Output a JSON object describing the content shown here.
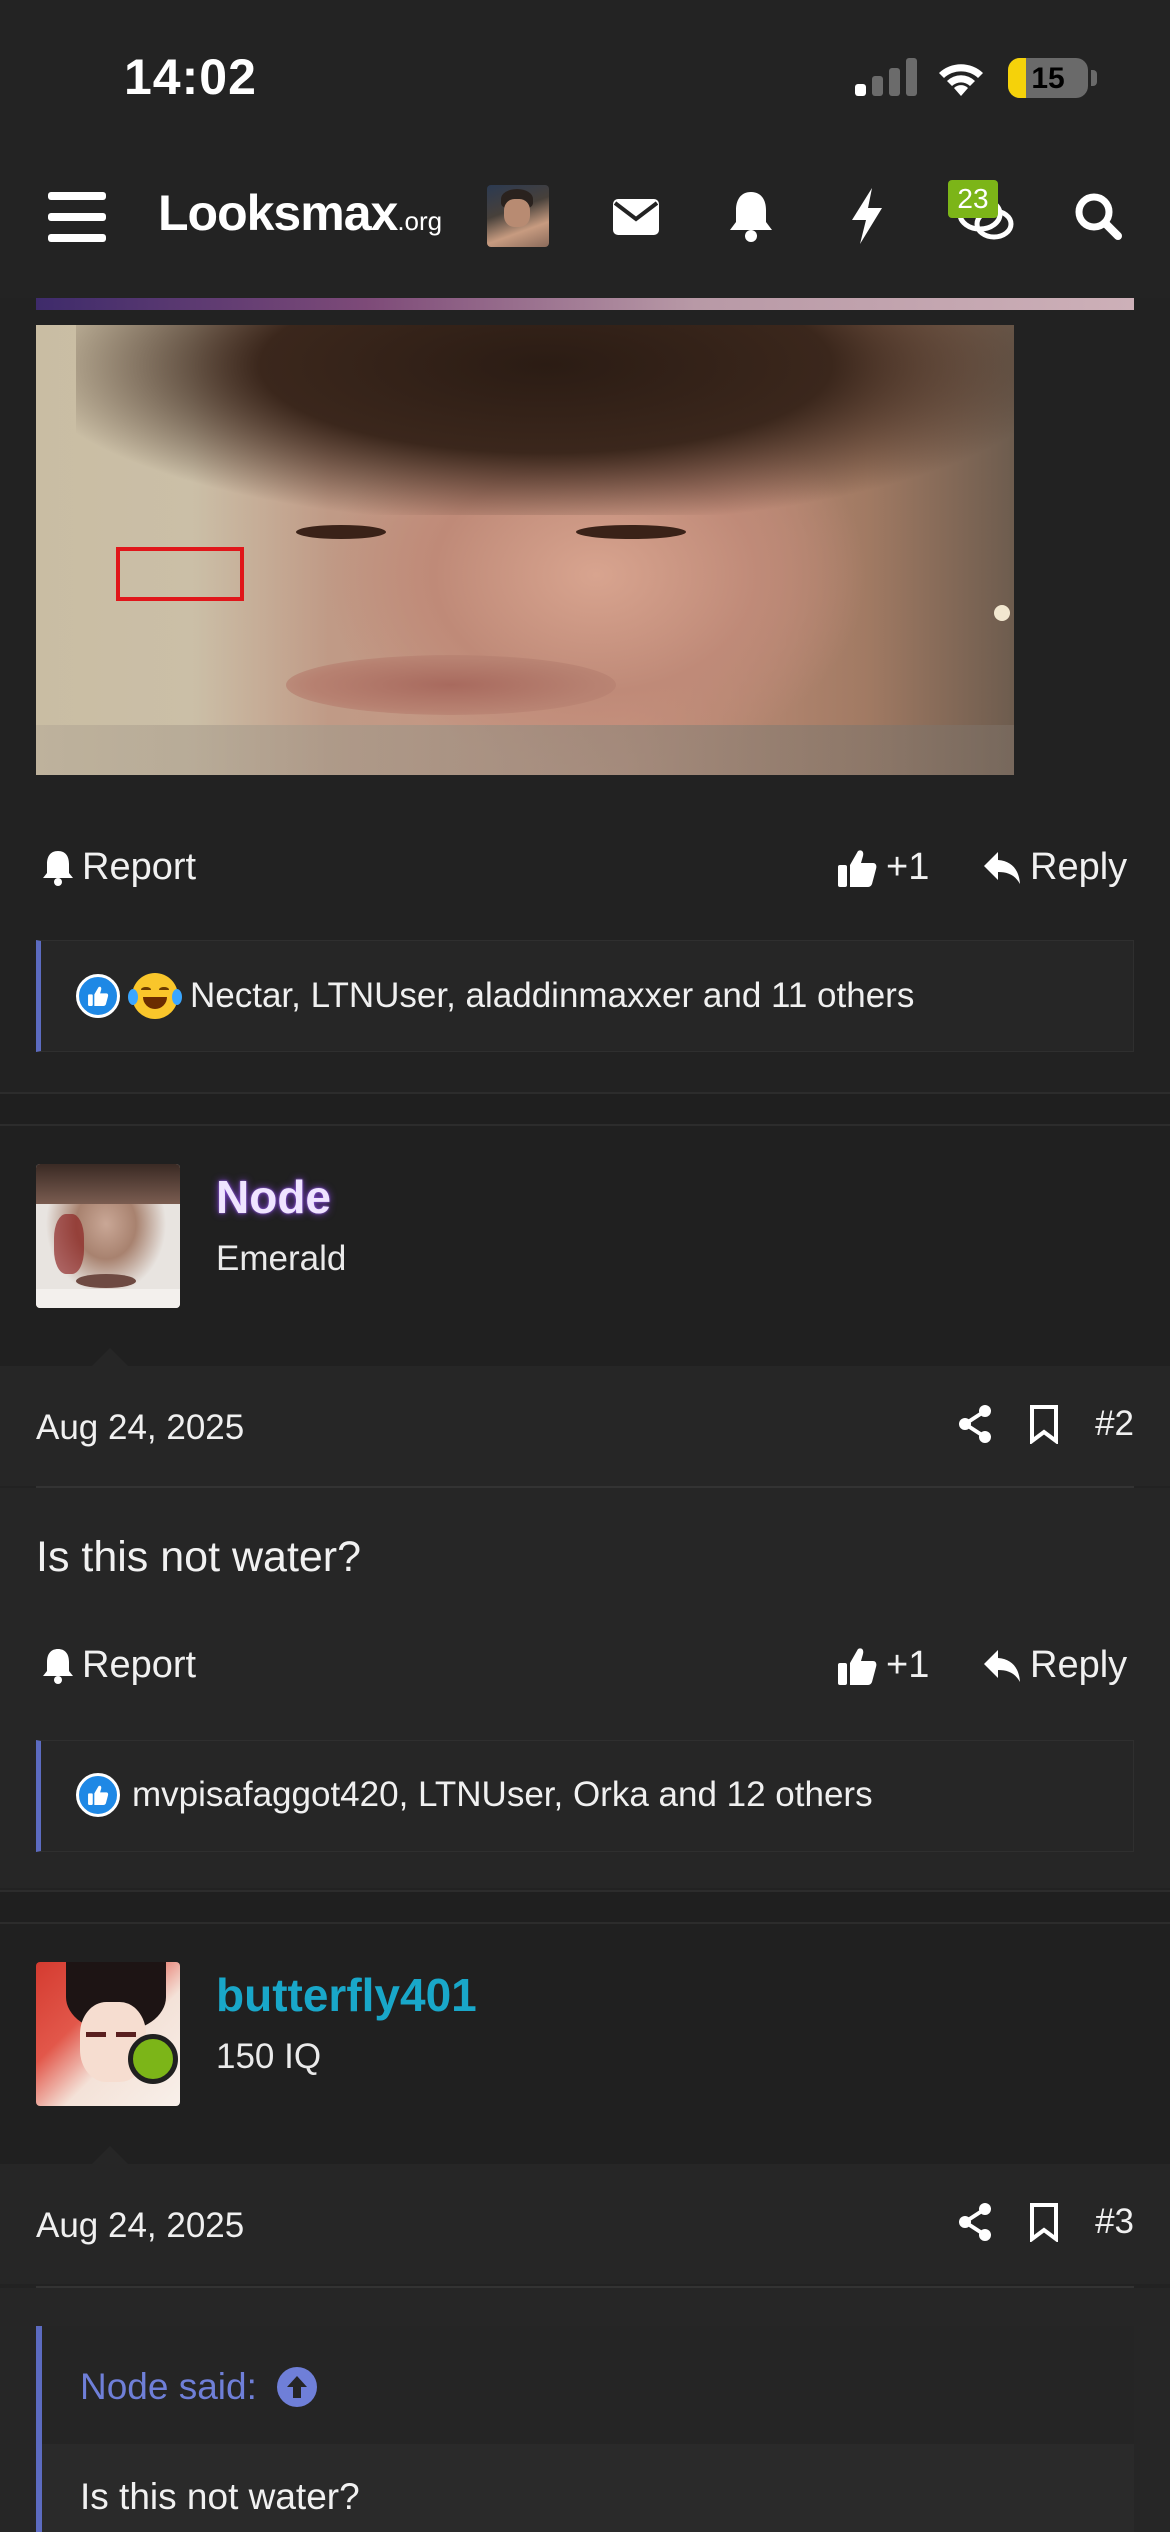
{
  "status_bar": {
    "time": "14:02",
    "battery": "15"
  },
  "nav": {
    "logo_main": "Looksmax",
    "logo_sub": ".org",
    "conversations_badge": "23"
  },
  "post1_actions": {
    "report": "Report",
    "like_count": "+1",
    "reply": "Reply"
  },
  "post1_reactions": {
    "text": "Nectar, LTNUser, aladdinmaxxer and 11 others"
  },
  "post2": {
    "username": "Node",
    "user_title": "Emerald",
    "date": "Aug 24, 2025",
    "number": "#2",
    "body": "Is this not water?",
    "actions": {
      "report": "Report",
      "like_count": "+1",
      "reply": "Reply"
    },
    "reactions": "mvpisafaggot420, LTNUser, Orka and 12 others"
  },
  "post3": {
    "username": "butterfly401",
    "user_title": "150 IQ",
    "date": "Aug 24, 2025",
    "number": "#3",
    "quote_author": "Node said:",
    "quote_text": "Is this not water?"
  },
  "colors": {
    "background": "#222222",
    "accent": "#5c6bc0",
    "username_node": "#e9ddff",
    "username_butterfly": "#19a7c9",
    "badge": "#7cb518",
    "like_blue": "#1e88e5"
  }
}
